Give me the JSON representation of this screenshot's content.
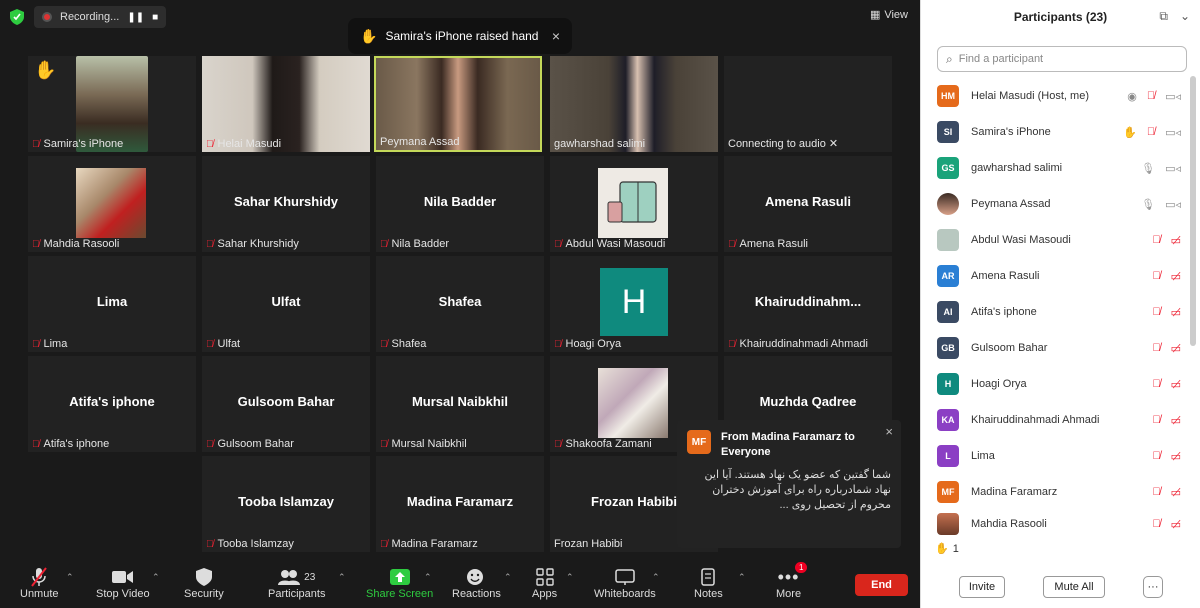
{
  "recording": {
    "label": "Recording..."
  },
  "view": {
    "label": "View"
  },
  "raise_toast": {
    "text": "Samira's iPhone raised hand",
    "close": "×"
  },
  "tiles": {
    "samira": "Samira's iPhone",
    "helai": "Helai Masudi",
    "peymana": "Peymana Assad",
    "gawharshad": "gawharshad salimi",
    "connecting": "Connecting to audio ✕",
    "mahdia": "Mahdia Rasooli",
    "sahar_center": "Sahar Khurshidy",
    "sahar": "Sahar Khurshidy",
    "nila_center": "Nila Badder",
    "nila": "Nila Badder",
    "abdul": "Abdul Wasi Masoudi",
    "amena_center": "Amena Rasuli",
    "amena": "Amena Rasuli",
    "lima_center": "Lima",
    "lima": "Lima",
    "ulfat_center": "Ulfat",
    "ulfat": "Ulfat",
    "shafea_center": "Shafea",
    "shafea": "Shafea",
    "hoagi_letter": "H",
    "hoagi": "Hoagi Orya",
    "khair_center": "Khairuddinahm...",
    "khair": "Khairuddinahmadi Ahmadi",
    "atifa_center": "Atifa's iphone",
    "atifa": "Atifa's iphone",
    "gulsoom_center": "Gulsoom Bahar",
    "gulsoom": "Gulsoom Bahar",
    "mursal_center": "Mursal Naibkhil",
    "mursal": "Mursal Naibkhil",
    "shakoofa": "Shakoofa Zamani",
    "muzhda_center": "Muzhda Qadree",
    "tooba_center": "Tooba Islamzay",
    "tooba": "Tooba Islamzay",
    "madina_center": "Madina Faramarz",
    "madina": "Madina Faramarz",
    "frozan_center": "Frozan Habibi",
    "frozan": "Frozan Habibi"
  },
  "chat_toast": {
    "initials": "MF",
    "from": "From Madina Faramarz to Everyone",
    "message": "شما گفتین که عضو یک نهاد هستند. آیا این نهاد شمادرباره راه برای آموزش دختران محروم از تحصیل روی ...",
    "close": "×"
  },
  "toolbar": {
    "unmute": "Unmute",
    "stop_video": "Stop Video",
    "security": "Security",
    "participants": "Participants",
    "participants_count": "23",
    "share_screen": "Share Screen",
    "reactions": "Reactions",
    "apps": "Apps",
    "whiteboards": "Whiteboards",
    "notes": "Notes",
    "more": "More",
    "more_badge": "1",
    "end": "End"
  },
  "panel": {
    "title": "Participants (23)",
    "search_placeholder": "Find a participant",
    "raised_count": "1",
    "invite": "Invite",
    "mute_all": "Mute All",
    "more": "···",
    "participants": [
      {
        "initials": "HM",
        "name": "Helai Masudi (Host, me)",
        "color": "#e56a1b"
      },
      {
        "initials": "SI",
        "name": "Samira's iPhone",
        "color": "#3a4a63"
      },
      {
        "initials": "GS",
        "name": "gawharshad salimi",
        "color": "#1aa37a"
      },
      {
        "initials": "",
        "name": "Peymana Assad",
        "color": "#8a4a3a"
      },
      {
        "initials": "",
        "name": "Abdul Wasi Masoudi",
        "color": "#b8c8c0"
      },
      {
        "initials": "AR",
        "name": "Amena Rasuli",
        "color": "#2a7fd4"
      },
      {
        "initials": "AI",
        "name": "Atifa's iphone",
        "color": "#3a4a63"
      },
      {
        "initials": "GB",
        "name": "Gulsoom Bahar",
        "color": "#3a4a63"
      },
      {
        "initials": "H",
        "name": "Hoagi Orya",
        "color": "#0f8a7e"
      },
      {
        "initials": "KA",
        "name": "Khairuddinahmadi Ahmadi",
        "color": "#8b3fc4"
      },
      {
        "initials": "L",
        "name": "Lima",
        "color": "#8b3fc4"
      },
      {
        "initials": "MF",
        "name": "Madina Faramarz",
        "color": "#e56a1b"
      },
      {
        "initials": "",
        "name": "Mahdia Rasooli",
        "color": "#c47050"
      }
    ]
  }
}
